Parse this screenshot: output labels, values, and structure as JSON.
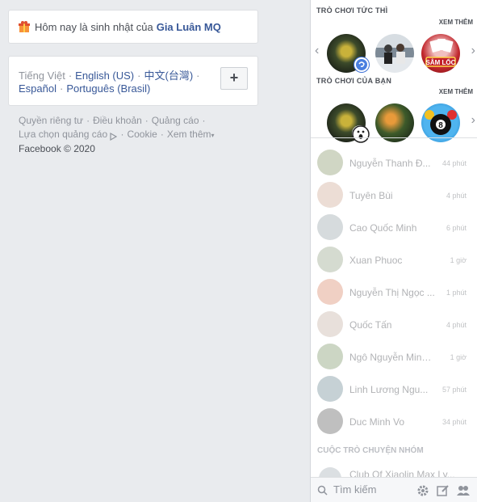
{
  "birthday": {
    "text": "Hôm nay là sinh nhật của",
    "name": "Gia Luân MQ"
  },
  "languages": {
    "current": "Tiếng Việt",
    "links": [
      "English (US)",
      "中文(台灣)",
      "Español",
      "Português (Brasil)"
    ],
    "add_label": "+"
  },
  "footer": {
    "links": [
      "Quyền riêng tư",
      "Điều khoản",
      "Quảng cáo",
      "Lựa chọn quảng cáo",
      "Cookie",
      "Xem thêm"
    ],
    "copyright": "Facebook © 2020"
  },
  "instant_games": {
    "title": "TRÒ CHƠI TỨC THÌ",
    "see_more": "XEM THÊM",
    "game3_label": "SÂM LỐC"
  },
  "your_games": {
    "title": "TRÒ CHƠI CỦA BẠN",
    "see_more": "XEM THÊM",
    "pool_number": "8"
  },
  "contacts": [
    {
      "name": "Nguyễn Thanh Đ...",
      "time": "44 phút",
      "color": "#7a8c5a"
    },
    {
      "name": "Tuyên Bùi",
      "time": "4 phút",
      "color": "#c9a089"
    },
    {
      "name": "Cao Quốc Minh",
      "time": "6 phút",
      "color": "#8d9aa0"
    },
    {
      "name": "Xuan Phuoc",
      "time": "1 giờ",
      "color": "#8a9a7a"
    },
    {
      "name": "Nguyễn Thị Ngọc ...",
      "time": "1 phút",
      "color": "#d67a5a"
    },
    {
      "name": "Quốc Tấn",
      "time": "4 phút",
      "color": "#bfa89a"
    },
    {
      "name": "Ngô Nguyễn Minh ...",
      "time": "1 giờ",
      "color": "#6f8c5a"
    },
    {
      "name": "Linh Lương Ngu...",
      "time": "57 phút",
      "color": "#5f7e8a"
    },
    {
      "name": "Duc Minh Vo",
      "time": "34 phút",
      "color": "#4a4a4a"
    }
  ],
  "group_chats": {
    "title": "CUỘC TRÒ CHUYỆN NHÓM",
    "first": "Club Of Xiaolin Max Ly..."
  },
  "search": {
    "placeholder": "Tìm kiếm"
  }
}
